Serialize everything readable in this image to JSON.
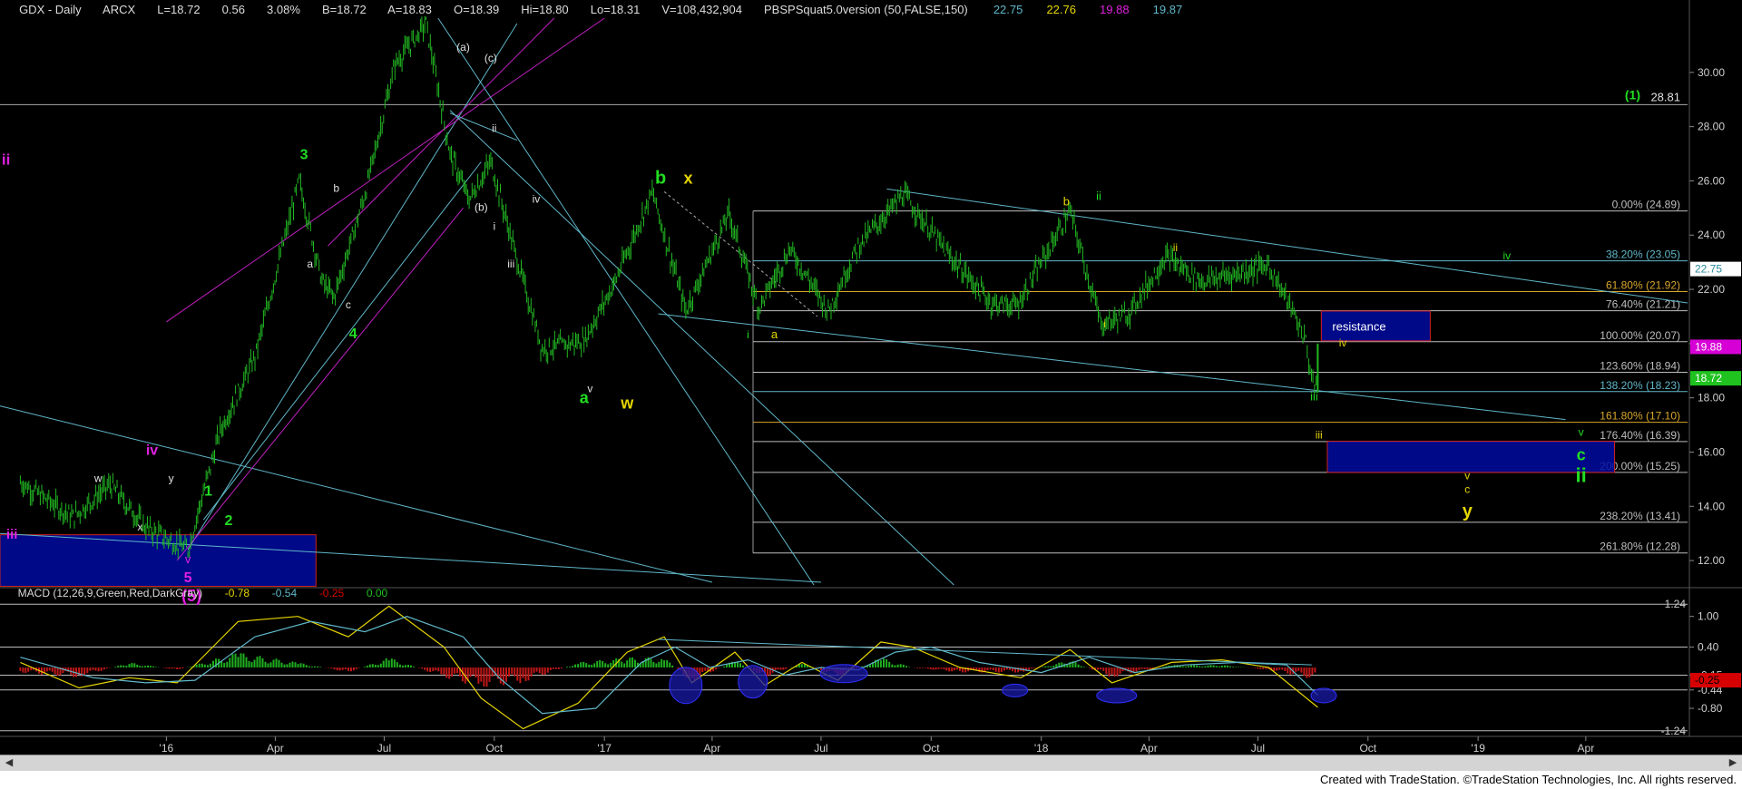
{
  "header": {
    "symbol": "GDX - Daily",
    "exchange": "ARCX",
    "last": "L=18.72",
    "change": "0.56",
    "change_pct": "3.08%",
    "bid": "B=18.72",
    "ask": "A=18.83",
    "open": "O=18.39",
    "high": "Hi=18.80",
    "low": "Lo=18.31",
    "volume": "V=108,432,904",
    "study": "PBSPSquat5.0version (50,FALSE,150)",
    "study_values": [
      "22.75",
      "22.76",
      "19.88",
      "19.87"
    ]
  },
  "chart_data": [
    {
      "type": "line",
      "panel": "price",
      "title": "GDX - Daily",
      "ylim": [
        11,
        32
      ],
      "y_ticks": [
        "30.00",
        "28.00",
        "26.00",
        "24.00",
        "22.00",
        "20.00",
        "18.00",
        "16.00",
        "14.00",
        "12.00"
      ],
      "x_ticks": [
        "'16",
        "Apr",
        "Jul",
        "Oct",
        "'17",
        "Apr",
        "Jul",
        "Oct",
        "'18",
        "Apr",
        "Jul",
        "Oct",
        "'19",
        "Apr"
      ],
      "series": [
        {
          "x": [
            "2015-09-01",
            "2015-10-15",
            "2015-11-15",
            "2015-12-15",
            "2016-01-19",
            "2016-02-15",
            "2016-03-15",
            "2016-04-21",
            "2016-05-10",
            "2016-05-20",
            "2016-06-15",
            "2016-07-10",
            "2016-08-05",
            "2016-08-25",
            "2016-09-10",
            "2016-09-28",
            "2016-10-20",
            "2016-11-10",
            "2016-12-15",
            "2017-01-10",
            "2017-02-10",
            "2017-03-10",
            "2017-04-15",
            "2017-05-10",
            "2017-06-05",
            "2017-07-07",
            "2017-08-01",
            "2017-09-08",
            "2017-10-15",
            "2017-11-20",
            "2017-12-12",
            "2018-01-25",
            "2018-02-20",
            "2018-03-15",
            "2018-04-15",
            "2018-05-15",
            "2018-06-15",
            "2018-07-10",
            "2018-07-30",
            "2018-08-10",
            "2018-08-16",
            "2018-08-20"
          ],
          "values": [
            14.9,
            13.6,
            14.8,
            13.2,
            12.4,
            16.8,
            19.5,
            26.0,
            22.3,
            21.7,
            25.5,
            30.3,
            31.8,
            27.0,
            25.3,
            26.7,
            23.1,
            19.8,
            20.1,
            22.3,
            25.6,
            21.2,
            24.8,
            21.3,
            23.5,
            21.2,
            23.6,
            25.5,
            23.3,
            21.5,
            21.4,
            24.9,
            20.7,
            21.1,
            23.2,
            22.3,
            22.6,
            22.9,
            21.2,
            20.1,
            18.4,
            18.72
          ]
        }
      ],
      "last_price": "18.72",
      "markers": [
        {
          "label": "19.88",
          "color": "#d600d6"
        },
        {
          "label": "18.72",
          "color": "#1fc21f"
        },
        {
          "label": "22.75",
          "color": "#0a0a0a"
        }
      ],
      "fib_levels": [
        {
          "label": "0.00% (24.89)",
          "value": 24.89,
          "color": "#bdbdbd"
        },
        {
          "label": "38.20% (23.05)",
          "value": 23.05,
          "color": "#5fb7c9"
        },
        {
          "label": "61.80% (21.92)",
          "value": 21.92,
          "color": "#d7a62b"
        },
        {
          "label": "76.40% (21.21)",
          "value": 21.21,
          "color": "#bdbdbd"
        },
        {
          "label": "100.00% (20.07)",
          "value": 20.07,
          "color": "#bdbdbd"
        },
        {
          "label": "123.60% (18.94)",
          "value": 18.94,
          "color": "#bdbdbd"
        },
        {
          "label": "138.20% (18.23)",
          "value": 18.23,
          "color": "#5fb7c9"
        },
        {
          "label": "161.80% (17.10)",
          "value": 17.1,
          "color": "#d7a62b"
        },
        {
          "label": "176.40% (16.39)",
          "value": 16.39,
          "color": "#bdbdbd"
        },
        {
          "label": "200.00% (15.25)",
          "value": 15.25,
          "color": "#bdbdbd"
        },
        {
          "label": "238.20% (13.41)",
          "value": 13.41,
          "color": "#bdbdbd"
        },
        {
          "label": "261.80% (12.28)",
          "value": 12.28,
          "color": "#bdbdbd"
        }
      ],
      "top_level": {
        "label": "28.81",
        "value": 28.81,
        "wave": "(1)"
      },
      "boxes": [
        {
          "label": "resistance"
        },
        {
          "label": ""
        },
        {
          "label": ""
        }
      ],
      "annotations": [
        {
          "text": "ii",
          "color": "#e020e0"
        },
        {
          "text": "iii",
          "color": "#e020e0"
        },
        {
          "text": "iv",
          "color": "#e020e0"
        },
        {
          "text": "v",
          "color": "#e020e0"
        },
        {
          "text": "5",
          "color": "#e020e0"
        },
        {
          "text": "(5)",
          "color": "#e020e0"
        },
        {
          "text": "w",
          "color": "#e0e0e0"
        },
        {
          "text": "x",
          "color": "#e0e0e0"
        },
        {
          "text": "y",
          "color": "#e0e0e0"
        },
        {
          "text": "1",
          "color": "#22dd22"
        },
        {
          "text": "2",
          "color": "#22dd22"
        },
        {
          "text": "3",
          "color": "#22dd22"
        },
        {
          "text": "4",
          "color": "#22dd22"
        },
        {
          "text": "a",
          "color": "#e0e0e0"
        },
        {
          "text": "b",
          "color": "#e0e0e0"
        },
        {
          "text": "c",
          "color": "#e0e0e0"
        },
        {
          "text": "(a)",
          "color": "#e0e0e0"
        },
        {
          "text": "(c)",
          "color": "#e0e0e0"
        },
        {
          "text": "(b)",
          "color": "#e0e0e0"
        },
        {
          "text": "i",
          "color": "#e0e0e0"
        },
        {
          "text": "ii",
          "color": "#e0e0e0"
        },
        {
          "text": "iii",
          "color": "#e0e0e0"
        },
        {
          "text": "iv",
          "color": "#e0e0e0"
        },
        {
          "text": "v",
          "color": "#e0e0e0"
        },
        {
          "text": "a",
          "color": "#22dd22"
        },
        {
          "text": "w",
          "color": "#e6d600"
        },
        {
          "text": "b",
          "color": "#22dd22"
        },
        {
          "text": "x",
          "color": "#e6d600"
        },
        {
          "text": "i",
          "color": "#22dd22"
        },
        {
          "text": "a",
          "color": "#e6d600"
        },
        {
          "text": "b",
          "color": "#e6d600"
        },
        {
          "text": "ii",
          "color": "#22dd22"
        },
        {
          "text": "i",
          "color": "#e6d600"
        },
        {
          "text": "ii",
          "color": "#e6d600"
        },
        {
          "text": "iii",
          "color": "#22dd22"
        },
        {
          "text": "iv",
          "color": "#e6d600"
        },
        {
          "text": "iii",
          "color": "#e6d600"
        },
        {
          "text": "iv",
          "color": "#22dd22"
        },
        {
          "text": "v",
          "color": "#22dd22"
        },
        {
          "text": "c",
          "color": "#22dd22"
        },
        {
          "text": "ii",
          "color": "#22dd22"
        },
        {
          "text": "v",
          "color": "#e6d600"
        },
        {
          "text": "c",
          "color": "#e6d600"
        },
        {
          "text": "y",
          "color": "#e6d600"
        }
      ]
    },
    {
      "type": "area",
      "panel": "macd",
      "title": "MACD (12,26,9,Green,Red,DarkGray)",
      "values_text": [
        "-0.78",
        "-0.54",
        "-0.25",
        "0.00"
      ],
      "ylim": [
        -1.35,
        1.35
      ],
      "y_ticks": [
        "1.00",
        "0.40",
        "-0.15",
        "-0.44",
        "-0.80"
      ],
      "level_labels": [
        "1.24",
        "-1.24"
      ],
      "last_values": [
        {
          "label": "-0.25",
          "color": "#d60000"
        }
      ],
      "series": [
        {
          "name": "MACD",
          "color": "#e6d600",
          "x": [
            "2015-09-01",
            "2015-10-20",
            "2015-12-01",
            "2016-01-10",
            "2016-03-01",
            "2016-04-20",
            "2016-06-01",
            "2016-07-05",
            "2016-08-20",
            "2016-09-20",
            "2016-10-25",
            "2016-12-10",
            "2017-01-20",
            "2017-02-20",
            "2017-03-15",
            "2017-04-20",
            "2017-05-15",
            "2017-06-15",
            "2017-07-15",
            "2017-08-20",
            "2017-09-15",
            "2017-10-25",
            "2017-12-15",
            "2018-01-25",
            "2018-03-01",
            "2018-04-20",
            "2018-06-01",
            "2018-07-10",
            "2018-08-20"
          ],
          "values": [
            0.1,
            -0.4,
            -0.2,
            -0.3,
            0.9,
            1.0,
            0.6,
            1.2,
            0.4,
            -0.6,
            -1.2,
            -0.7,
            0.3,
            0.6,
            -0.3,
            0.3,
            -0.35,
            0.1,
            -0.25,
            0.5,
            0.4,
            0.0,
            -0.2,
            0.35,
            -0.3,
            0.1,
            0.15,
            0.0,
            -0.78
          ]
        },
        {
          "name": "Signal",
          "color": "#5fb7c9",
          "x": [
            "2015-09-01",
            "2015-11-01",
            "2015-12-15",
            "2016-01-25",
            "2016-03-15",
            "2016-05-01",
            "2016-06-15",
            "2016-07-20",
            "2016-09-05",
            "2016-10-05",
            "2016-11-10",
            "2016-12-25",
            "2017-02-01",
            "2017-03-01",
            "2017-03-30",
            "2017-05-01",
            "2017-06-01",
            "2017-07-01",
            "2017-08-01",
            "2017-09-01",
            "2017-10-01",
            "2017-11-10",
            "2018-01-01",
            "2018-02-10",
            "2018-03-20",
            "2018-05-01",
            "2018-06-15",
            "2018-07-25",
            "2018-08-20"
          ],
          "values": [
            0.2,
            -0.2,
            -0.3,
            -0.25,
            0.6,
            0.9,
            0.7,
            1.0,
            0.6,
            -0.2,
            -0.9,
            -0.8,
            0.1,
            0.4,
            0.0,
            0.15,
            -0.15,
            0.0,
            -0.05,
            0.3,
            0.4,
            0.1,
            -0.1,
            0.2,
            -0.1,
            0.05,
            0.1,
            0.05,
            -0.54
          ]
        }
      ],
      "histogram": {
        "x": [
          "2015-09-01",
          "2015-10-20",
          "2015-12-01",
          "2016-01-10",
          "2016-03-01",
          "2016-04-20",
          "2016-06-01",
          "2016-07-05",
          "2016-08-20",
          "2016-09-20",
          "2016-10-25",
          "2016-12-10",
          "2017-01-20",
          "2017-02-20",
          "2017-03-15",
          "2017-04-20",
          "2017-05-15",
          "2017-06-15",
          "2017-07-15",
          "2017-08-20",
          "2017-09-15",
          "2017-10-25",
          "2017-12-15",
          "2018-01-25",
          "2018-03-01",
          "2018-04-20",
          "2018-06-01",
          "2018-07-10",
          "2018-08-20"
        ],
        "values": [
          -0.1,
          -0.2,
          0.1,
          -0.05,
          0.3,
          0.1,
          -0.1,
          0.2,
          -0.2,
          -0.4,
          -0.3,
          0.1,
          0.2,
          0.2,
          -0.3,
          0.15,
          -0.2,
          0.1,
          -0.2,
          0.2,
          0.0,
          -0.1,
          -0.1,
          0.15,
          -0.2,
          0.05,
          0.05,
          -0.05,
          -0.25
        ]
      }
    }
  ],
  "footer": {
    "text": "Created with TradeStation. ©TradeStation Technologies, Inc. All rights reserved."
  }
}
